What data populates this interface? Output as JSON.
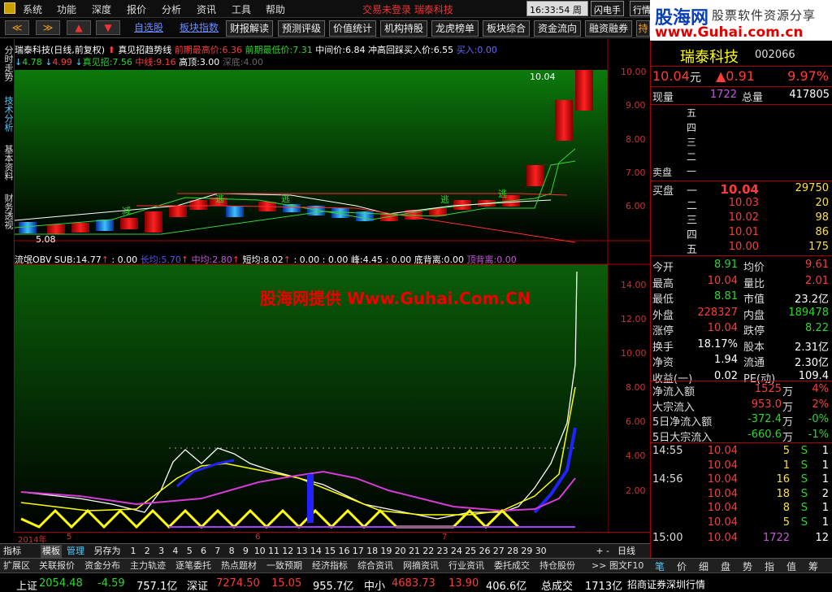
{
  "menu": {
    "items": [
      "系统",
      "功能",
      "深度",
      "报价",
      "分析",
      "资讯",
      "工具",
      "帮助"
    ],
    "status": "交易未登录  瑞泰科技",
    "time": "16:33:54 周一",
    "flash": "闪电手",
    "quote": "行情"
  },
  "toolbar": {
    "nav": [
      "≪",
      "≫",
      "▲",
      "▼"
    ],
    "buttons": [
      "自选股",
      "板块指数",
      "财报解读",
      "预测评级",
      "价值统计",
      "机构持股",
      "龙虎榜单",
      "板块综合",
      "资金流向",
      "融资融券",
      "持"
    ]
  },
  "logo": {
    "name": "股海网",
    "slogan": "股票软件资源分享",
    "url": "www.Guhai.com.cn"
  },
  "left_tabs": [
    "分时走势",
    "技术分析",
    "基本资料",
    "财务透视"
  ],
  "main_legend": {
    "title": "瑞泰科技(日线,前复权)",
    "indicator": "真见招趋势线",
    "prev_high_lbl": "前期最高价:",
    "prev_high": "6.36",
    "prev_low_lbl": "前期最低价:",
    "prev_low": "7.31",
    "mid_lbl": "中间价:",
    "mid": "6.84",
    "rebuy_lbl": "冲高回踩买入价:",
    "rebuy": "6.55",
    "buy_lbl": "买入:",
    "buy": "0.00",
    "v1": "4.78",
    "v2": "4.99",
    "real_lbl": "真见招:",
    "real": "7.56",
    "zx_lbl": "中线:",
    "zx": "9.16",
    "gd_lbl": "高顶:",
    "gd": "3.00",
    "sd_lbl": "深底:",
    "sd": "4.00"
  },
  "main_axis": [
    "10.00",
    "9.00",
    "8.00",
    "7.00",
    "6.00"
  ],
  "main_labels": {
    "peak": "10.04",
    "low": "5.08",
    "sig1": "减",
    "sig2": "逃",
    "sig3": "逃",
    "sig4": "逃",
    "sig5": "逃"
  },
  "sub_legend": {
    "name": "流氓OBV",
    "sub_lbl": "SUB:",
    "sub": "14.77",
    "z1": ": 0.00",
    "cc_lbl": "长均:",
    "cc": "5.70",
    "zj_lbl": "中均:",
    "zj": "2.80",
    "dj_lbl": "短均:",
    "dj": "8.02",
    "z2": ": 0.00",
    "z3": ": 0.00",
    "peak_lbl": "峰:",
    "peak": "4.45",
    "z4": ": 0.00",
    "dbl_lbl": "底背离:",
    "dbl": "0.00",
    "tbl_lbl": "顶背离:",
    "tbl": "0.00"
  },
  "sub_axis": [
    "14.00",
    "12.00",
    "10.00",
    "8.00",
    "6.00",
    "4.00",
    "2.00"
  ],
  "watermark": "股海网提供 Www.Guhai.Com.CN",
  "dates": {
    "year": "2014年",
    "m5": "5",
    "m6": "6",
    "m7": "7"
  },
  "period_row": {
    "items": [
      "指标",
      "模板",
      "管理",
      "另存为"
    ],
    "nums": [
      "1",
      "2",
      "3",
      "4",
      "5",
      "6",
      "7",
      "8",
      "9",
      "10",
      "11",
      "12",
      "13",
      "14",
      "15",
      "16",
      "17",
      "18",
      "19",
      "20",
      "21",
      "22",
      "23",
      "24",
      "25",
      "26",
      "27",
      "28",
      "29",
      "30"
    ],
    "daily": "日线",
    "plus": "+",
    "minus": "-"
  },
  "func_row": [
    "扩展区",
    "关联报价",
    "资金分布",
    "主力轨迹",
    "逐笔委托",
    "热点题材",
    "一致预期",
    "经济指标",
    "综合资讯",
    "网摘资讯",
    "行业资讯",
    "委托成交",
    "持仓股份",
    ">>",
    "图文F10"
  ],
  "stock": {
    "name": "瑞泰科技",
    "code": "002066",
    "price": "10.04",
    "unit": "元",
    "change": "▲0.91",
    "pct": "9.97%"
  },
  "vol": {
    "now_lbl": "现量",
    "now": "1722",
    "total_lbl": "总量",
    "total": "417805"
  },
  "sell": {
    "lbl": "卖盘",
    "levels": [
      "五",
      "四",
      "三",
      "二",
      "一"
    ]
  },
  "buy": {
    "lbl": "买盘",
    "levels": [
      {
        "n": "一",
        "p": "10.04",
        "v": "29750"
      },
      {
        "n": "二",
        "p": "10.03",
        "v": "20"
      },
      {
        "n": "三",
        "p": "10.02",
        "v": "98"
      },
      {
        "n": "四",
        "p": "10.01",
        "v": "86"
      },
      {
        "n": "五",
        "p": "10.00",
        "v": "175"
      }
    ]
  },
  "stats": [
    {
      "l1": "今开",
      "v1": "8.91",
      "l2": "均价",
      "v2": "9.61",
      "c1": "green",
      "c2": "red"
    },
    {
      "l1": "最高",
      "v1": "10.04",
      "l2": "量比",
      "v2": "2.01",
      "c1": "red",
      "c2": "red"
    },
    {
      "l1": "最低",
      "v1": "8.81",
      "l2": "市值",
      "v2": "23.2亿",
      "c1": "green",
      "c2": "white"
    },
    {
      "l1": "外盘",
      "v1": "228327",
      "l2": "内盘",
      "v2": "189478",
      "c1": "red",
      "c2": "green"
    },
    {
      "l1": "涨停",
      "v1": "10.04",
      "l2": "跌停",
      "v2": "8.22",
      "c1": "red",
      "c2": "green"
    },
    {
      "l1": "换手",
      "v1": "18.17%",
      "l2": "股本",
      "v2": "2.31亿",
      "c1": "white",
      "c2": "white"
    },
    {
      "l1": "净资",
      "v1": "1.94",
      "l2": "流通",
      "v2": "2.30亿",
      "c1": "white",
      "c2": "white"
    },
    {
      "l1": "收益(一)",
      "v1": "0.02",
      "l2": "PE(动)",
      "v2": "109.4",
      "c1": "white",
      "c2": "white"
    }
  ],
  "flows": [
    {
      "l": "净流入额",
      "v": "1525",
      "u": "万",
      "p": "4%",
      "c": "red"
    },
    {
      "l": "大宗流入",
      "v": "953.0",
      "u": "万",
      "p": "2%",
      "c": "red"
    },
    {
      "l": "5日净流入额",
      "v": "-372.4",
      "u": "万",
      "p": "-0%",
      "c": "green"
    },
    {
      "l": "5日大宗流入",
      "v": "-660.6",
      "u": "万",
      "p": "-1%",
      "c": "green"
    }
  ],
  "ticks": [
    {
      "t": "14:55",
      "p": "10.04",
      "v": "5",
      "s": "S",
      "n": "1"
    },
    {
      "t": "",
      "p": "10.04",
      "v": "1",
      "s": "S",
      "n": "1"
    },
    {
      "t": "14:56",
      "p": "10.04",
      "v": "16",
      "s": "S",
      "n": "1"
    },
    {
      "t": "",
      "p": "10.04",
      "v": "18",
      "s": "S",
      "n": "2"
    },
    {
      "t": "",
      "p": "10.04",
      "v": "8",
      "s": "S",
      "n": "1"
    },
    {
      "t": "",
      "p": "10.04",
      "v": "5",
      "s": "S",
      "n": "1"
    },
    {
      "t": "15:00",
      "p": "10.04",
      "v": "1722",
      "s": "",
      "n": "12"
    }
  ],
  "rp_tabs": [
    "笔",
    "价",
    "细",
    "盘",
    "势",
    "指",
    "值",
    "筹"
  ],
  "indexes": {
    "sh_lbl": "上证",
    "sh": "2054.48",
    "sh_ch": "-4.59",
    "sh_amt": "757.1亿",
    "sz_lbl": "深证",
    "sz": "7274.50",
    "sz_ch": "15.05",
    "sz_amt": "955.7亿",
    "zx_lbl": "中小",
    "zx": "4683.73",
    "zx_ch": "13.90",
    "zx_amt": "406.6亿",
    "total_lbl": "总成交",
    "total": "1713亿",
    "broker": "招商证券深圳行情"
  }
}
